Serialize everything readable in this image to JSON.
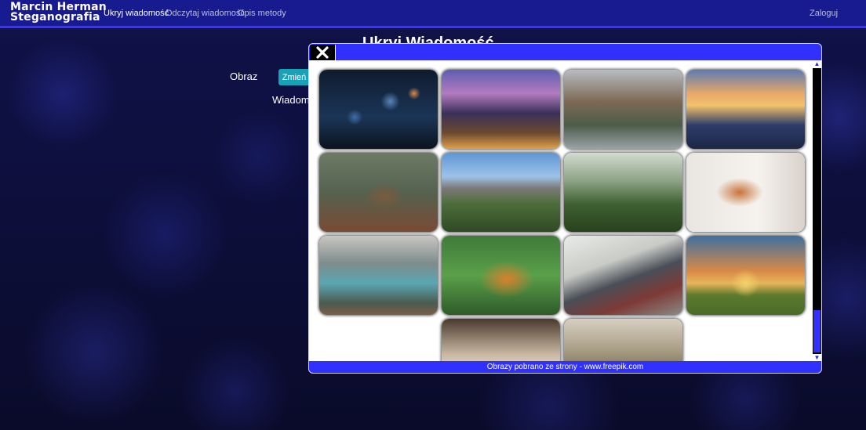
{
  "nav": {
    "brand_line1": "Marcin Herman",
    "brand_line2": "Steganografia",
    "links": [
      "Ukryj wiadomość",
      "Odczytaj wiadomość",
      "Opis metody"
    ],
    "login": "Zaloguj"
  },
  "page": {
    "title_partial": "Ukryj Wiadomość",
    "image_label": "Obraz",
    "change_button": "Zmień",
    "message_label": "Wiadomo"
  },
  "modal": {
    "footer_text": "Obrazy pobrano ze strony - www.freepik.com",
    "images": [
      "city-bokeh-night",
      "city-skyline-night",
      "autumn-forest-river",
      "city-sunset-skyline",
      "deer-in-field",
      "mountain-peaks",
      "misty-forest",
      "woman-with-cat",
      "forest-creek",
      "tiger",
      "stadium",
      "tree-sunset-field",
      "laptop-charts",
      "sunlit-forest-walk"
    ]
  },
  "colors": {
    "navbar": "#181b8f",
    "accent_blue": "#3030ff",
    "button_teal": "#17a2b8"
  }
}
